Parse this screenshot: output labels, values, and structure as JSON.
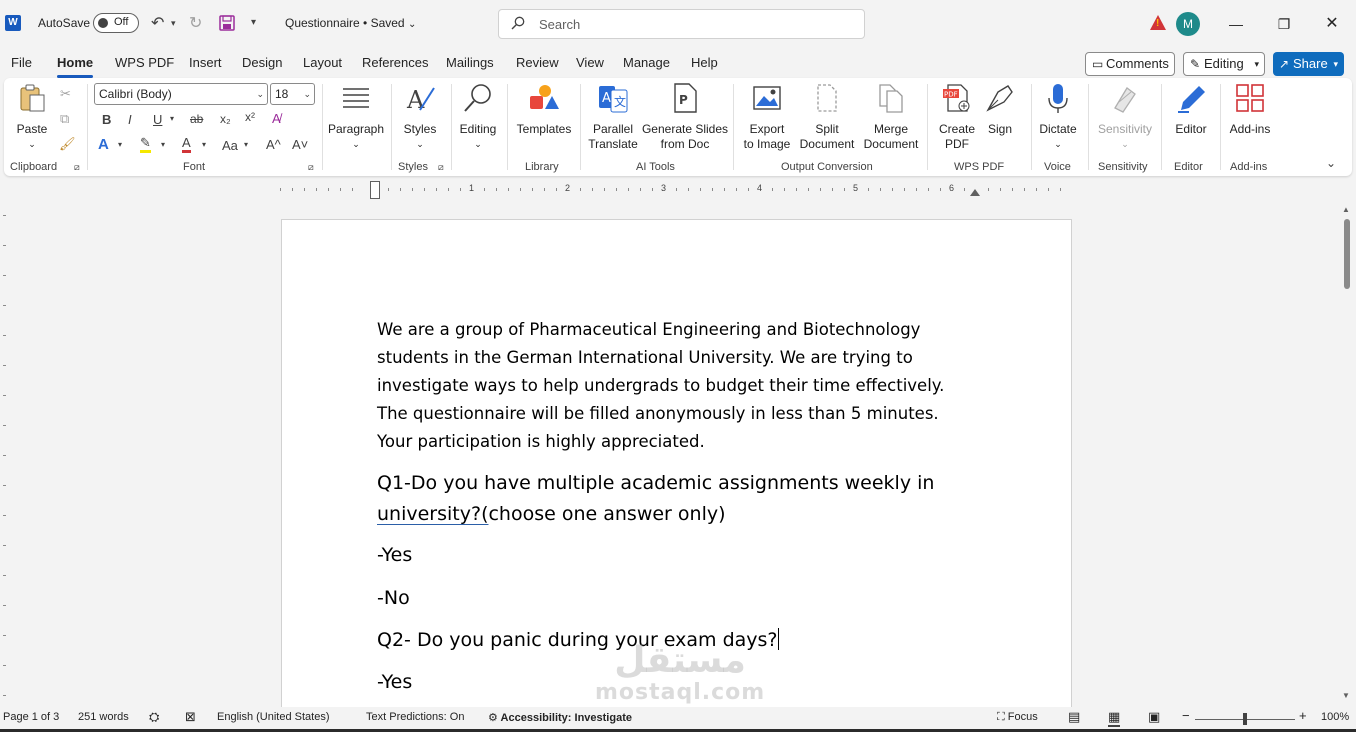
{
  "titlebar": {
    "autosave_label": "AutoSave",
    "autosave_state": "Off",
    "document_title": "Questionnaire • Saved",
    "search_placeholder": "Search",
    "avatar_initial": "M",
    "icons": [
      "word-logo-icon",
      "undo-icon",
      "redo-icon",
      "save-icon",
      "customize-icon",
      "search-icon",
      "warning-icon",
      "minimize-icon",
      "restore-icon",
      "close-icon"
    ]
  },
  "tabs": [
    "File",
    "Home",
    "WPS PDF",
    "Insert",
    "Design",
    "Layout",
    "References",
    "Mailings",
    "Review",
    "View",
    "Manage",
    "Help"
  ],
  "active_tab": "Home",
  "actions": {
    "comments": "Comments",
    "editing": "Editing",
    "share": "Share"
  },
  "ribbon": {
    "clipboard": {
      "paste": "Paste",
      "label": "Clipboard"
    },
    "font": {
      "name": "Calibri (Body)",
      "size": "18",
      "label": "Font",
      "bold": "B",
      "italic": "I",
      "underline": "U",
      "strike": "ab",
      "sub": "x₂",
      "sup": "x²",
      "case": "Aa",
      "grow": "A^",
      "shrink": "A˅"
    },
    "paragraph": {
      "label": "Paragraph"
    },
    "styles": {
      "button": "Styles",
      "label": "Styles"
    },
    "editing": {
      "button": "Editing"
    },
    "library": {
      "templates": "Templates",
      "label": "Library"
    },
    "ai_tools": {
      "parallel_1": "Parallel",
      "parallel_2": "Translate",
      "slides_1": "Generate Slides",
      "slides_2": "from Doc",
      "label": "AI Tools"
    },
    "output": {
      "export_1": "Export",
      "export_2": "to Image",
      "split_1": "Split",
      "split_2": "Document",
      "merge_1": "Merge",
      "merge_2": "Document",
      "label": "Output Conversion"
    },
    "wps_pdf": {
      "create_1": "Create",
      "create_2": "PDF",
      "sign": "Sign",
      "label": "WPS PDF"
    },
    "voice": {
      "dictate": "Dictate",
      "label": "Voice"
    },
    "sensitivity": {
      "button": "Sensitivity",
      "label": "Sensitivity"
    },
    "editor": {
      "button": "Editor",
      "label": "Editor"
    },
    "addins": {
      "button": "Add-ins",
      "label": "Add-ins"
    }
  },
  "ruler_numbers": [
    "1",
    "2",
    "3",
    "4",
    "5",
    "6"
  ],
  "document": {
    "intro": [
      "We are a group of Pharmaceutical Engineering and Biotechnology",
      "students in the German International University. We are trying to",
      "investigate ways to help undergrads to budget their time effectively.",
      "The questionnaire will be filled anonymously in less than 5 minutes.",
      "Your participation is highly appreciated."
    ],
    "q1_line1": "Q1-Do you have multiple academic assignments weekly in",
    "q1_underlined": "university?(",
    "q1_rest": "choose one answer only)",
    "q1_yes": "-Yes",
    "q1_no": "-No",
    "q2": "Q2- Do you panic during your exam days?",
    "q2_yes": "-Yes"
  },
  "watermark": {
    "arabic": "مستقل",
    "latin": "mostaql.com"
  },
  "statusbar": {
    "page": "Page 1 of 3",
    "words": "251 words",
    "language": "English (United States)",
    "predictions": "Text Predictions: On",
    "accessibility": "Accessibility: Investigate",
    "focus": "Focus",
    "zoom": "100%"
  },
  "colors": {
    "accent": "#185abd",
    "share": "#0f6cbd",
    "avatar": "#1e8a8a",
    "warning": "#d13438"
  }
}
